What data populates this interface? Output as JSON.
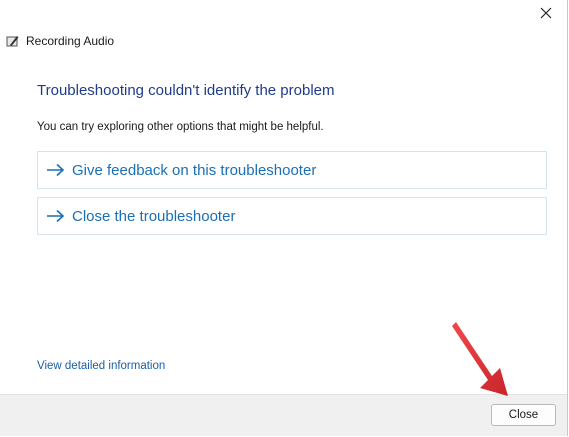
{
  "window": {
    "title": "Recording Audio",
    "close_icon": "close-icon",
    "app_icon": "microphone-icon"
  },
  "main": {
    "heading": "Troubleshooting couldn't identify the problem",
    "subtext": "You can try exploring other options that might be helpful.",
    "options": [
      {
        "label": "Give feedback on this troubleshooter",
        "icon": "arrow-right-icon"
      },
      {
        "label": "Close the troubleshooter",
        "icon": "arrow-right-icon"
      }
    ],
    "detail_link": "View detailed information"
  },
  "footer": {
    "close_label": "Close"
  },
  "colors": {
    "heading": "#1f3c8c",
    "link": "#1a6fb5",
    "pointer": "#e8383d"
  }
}
